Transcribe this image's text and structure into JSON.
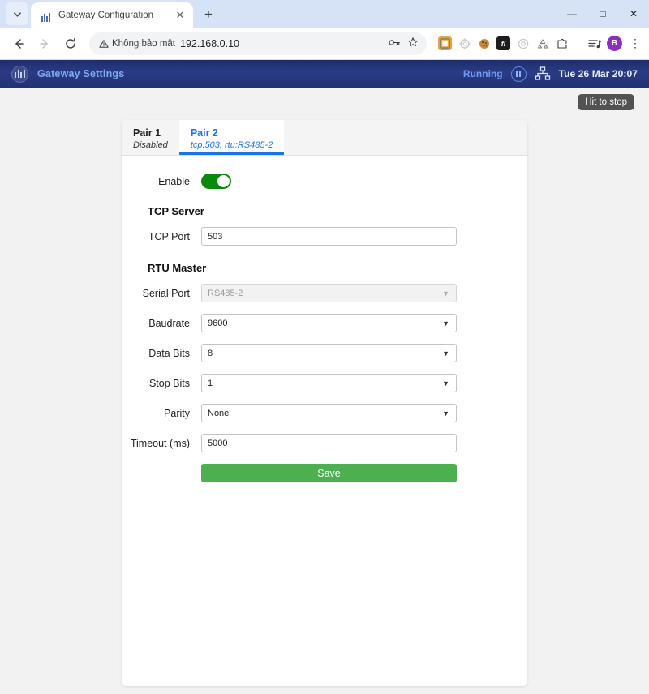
{
  "browser": {
    "tab": {
      "title": "Gateway Configuration",
      "favicon_icon": "factory-icon",
      "close_icon": "close-icon"
    },
    "tab_search_icon": "chevron-down-icon",
    "new_tab_label": "+",
    "window_controls": {
      "minimize": "—",
      "maximize": "□",
      "close": "✕"
    },
    "nav": {
      "back_icon": "arrow-left-icon",
      "forward_icon": "arrow-right-icon",
      "reload_icon": "reload-icon"
    },
    "omnibox": {
      "security_label": "Không bảo mật",
      "security_icon": "warning-triangle-icon",
      "url": "192.168.0.10",
      "password_icon": "key-icon",
      "bookmark_icon": "star-icon"
    },
    "extensions": [
      {
        "name": "extension-picture-icon",
        "glyph": "🖼"
      },
      {
        "name": "extension-gear-icon",
        "glyph": "⚙"
      },
      {
        "name": "extension-cookie-icon",
        "glyph": "🍪"
      },
      {
        "name": "extension-fi-icon",
        "glyph": "fi"
      },
      {
        "name": "extension-target-icon",
        "glyph": "◎"
      },
      {
        "name": "extension-recycle-icon",
        "glyph": "♻"
      },
      {
        "name": "extension-puzzle-icon",
        "glyph": "🧩"
      }
    ],
    "downloads_icon": "downloads-list-icon",
    "profile_initial": "B",
    "menu_icon": "kebab-menu-icon"
  },
  "appbar": {
    "logo_icon": "gateway-logo-icon",
    "title": "Gateway Settings",
    "status": "Running",
    "pause_icon": "pause-circle-icon",
    "network_icon": "network-topology-icon",
    "clock": "Tue 26 Mar 20:07"
  },
  "tooltip": {
    "text": "Hit to stop"
  },
  "tabs": [
    {
      "name": "Pair 1",
      "sub": "Disabled",
      "active": false
    },
    {
      "name": "Pair 2",
      "sub": "tcp:503, rtu:RS485-2",
      "active": true
    }
  ],
  "form": {
    "enable_label": "Enable",
    "enable_on": true,
    "sections": {
      "tcp": "TCP Server",
      "rtu": "RTU Master"
    },
    "fields": {
      "tcp_port": {
        "label": "TCP Port",
        "value": "503"
      },
      "serial_port": {
        "label": "Serial Port",
        "value": "RS485-2",
        "disabled": true
      },
      "baudrate": {
        "label": "Baudrate",
        "value": "9600"
      },
      "data_bits": {
        "label": "Data Bits",
        "value": "8"
      },
      "stop_bits": {
        "label": "Stop Bits",
        "value": "1"
      },
      "parity": {
        "label": "Parity",
        "value": "None"
      },
      "timeout": {
        "label": "Timeout (ms)",
        "value": "5000"
      }
    },
    "save_label": "Save"
  },
  "colors": {
    "accent_blue": "#1a73e8",
    "appbar_navy": "#233072",
    "toggle_green": "#0a8a0a",
    "save_green": "#4cb050",
    "status_blue": "#6f9af0"
  }
}
